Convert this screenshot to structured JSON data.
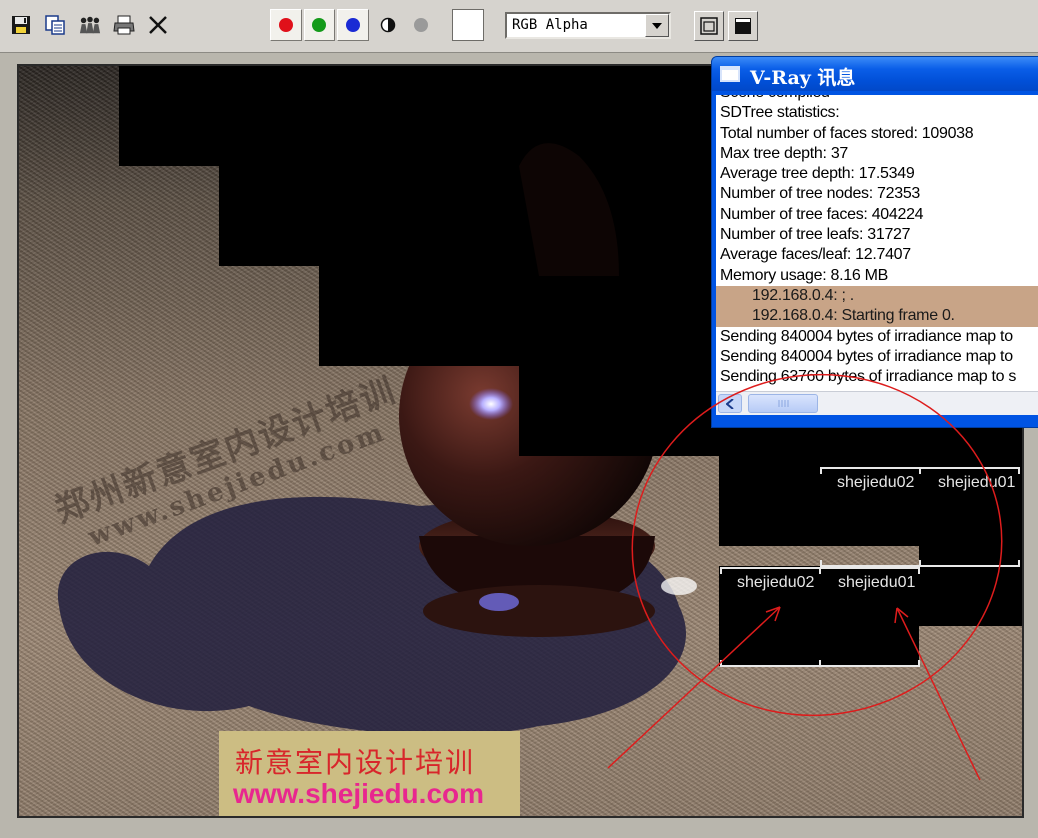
{
  "toolbar": {
    "icons": [
      "save-icon",
      "copy-icon",
      "clone-icon",
      "print-icon",
      "close-icon"
    ],
    "channels": [
      {
        "name": "red",
        "color": "#e0101a"
      },
      {
        "name": "green",
        "color": "#149a1a"
      },
      {
        "name": "blue",
        "color": "#1a2ad4"
      }
    ],
    "display_channel": "RGB Alpha"
  },
  "canvas": {
    "watermark_cn": "郑州新意室内设计培训",
    "watermark_url": "www.shejiedu.com",
    "caption_cn": "新意室内设计培训",
    "caption_url": "www.shejiedu.com",
    "bucket_labels": [
      "shejiedu02",
      "shejiedu01",
      "shejiedu02",
      "shejiedu01"
    ]
  },
  "vray_dialog": {
    "title": "V-Ray 讯息",
    "log_lines": [
      {
        "text": "Scene compiled",
        "highlight": false
      },
      {
        "text": "SDTree statistics:",
        "highlight": false
      },
      {
        "text": "Total number of faces stored: 109038",
        "highlight": false
      },
      {
        "text": "Max tree depth: 37",
        "highlight": false
      },
      {
        "text": "Average tree depth: 17.5349",
        "highlight": false
      },
      {
        "text": "Number of tree nodes: 72353",
        "highlight": false
      },
      {
        "text": "Number of tree faces: 404224",
        "highlight": false
      },
      {
        "text": "Number of tree leafs: 31727",
        "highlight": false
      },
      {
        "text": "Average faces/leaf: 12.7407",
        "highlight": false
      },
      {
        "text": "Memory usage: 8.16 MB",
        "highlight": false
      },
      {
        "text": "192.168.0.4:           ;        .",
        "highlight": true
      },
      {
        "text": "192.168.0.4: Starting frame 0.",
        "highlight": true
      },
      {
        "text": "Sending 840004 bytes of irradiance map to",
        "highlight": false
      },
      {
        "text": "Sending 840004 bytes of irradiance map to",
        "highlight": false
      },
      {
        "text": "Sending 63760 bytes of irradiance map to s",
        "highlight": false
      }
    ]
  },
  "colors": {
    "annotation": "#dd1c1c",
    "caption_cn": "#d8262b",
    "caption_url": "#e8278f",
    "title_bar": "#0a5ee8"
  }
}
